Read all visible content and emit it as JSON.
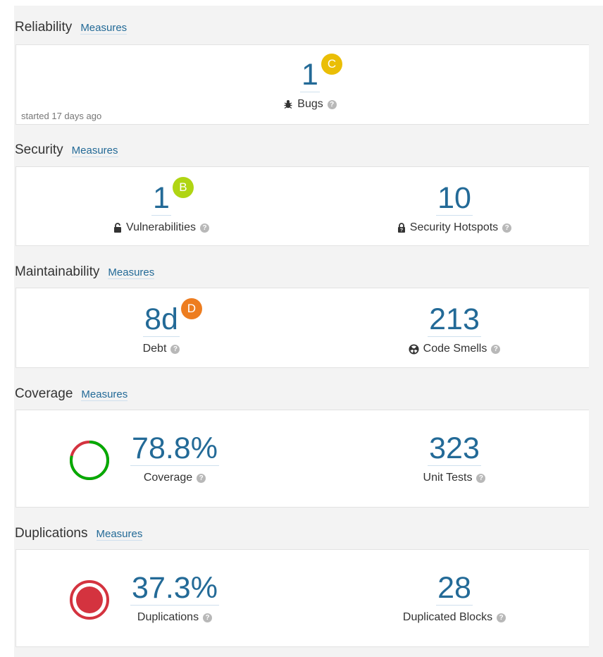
{
  "measures_label": "Measures",
  "reliability": {
    "title": "Reliability",
    "bugs": {
      "value": "1",
      "rating": "C",
      "rating_color": "#eabe06",
      "label": "Bugs"
    },
    "note": "started 17 days ago"
  },
  "security": {
    "title": "Security",
    "vulnerabilities": {
      "value": "1",
      "rating": "B",
      "rating_color": "#b0d513",
      "label": "Vulnerabilities"
    },
    "hotspots": {
      "value": "10",
      "label": "Security Hotspots"
    }
  },
  "maintainability": {
    "title": "Maintainability",
    "debt": {
      "value": "8d",
      "rating": "D",
      "rating_color": "#ed7d20",
      "label": "Debt"
    },
    "code_smells": {
      "value": "213",
      "label": "Code Smells"
    }
  },
  "coverage": {
    "title": "Coverage",
    "coverage": {
      "value": "78.8%",
      "label": "Coverage",
      "covered_fraction": 0.788,
      "covered_color": "#00aa00",
      "uncovered_color": "#d4333f"
    },
    "unit_tests": {
      "value": "323",
      "label": "Unit Tests"
    }
  },
  "duplications": {
    "title": "Duplications",
    "duplications": {
      "value": "37.3%",
      "label": "Duplications",
      "indicator_color": "#d4333f"
    },
    "duplicated_blocks": {
      "value": "28",
      "label": "Duplicated Blocks"
    }
  }
}
